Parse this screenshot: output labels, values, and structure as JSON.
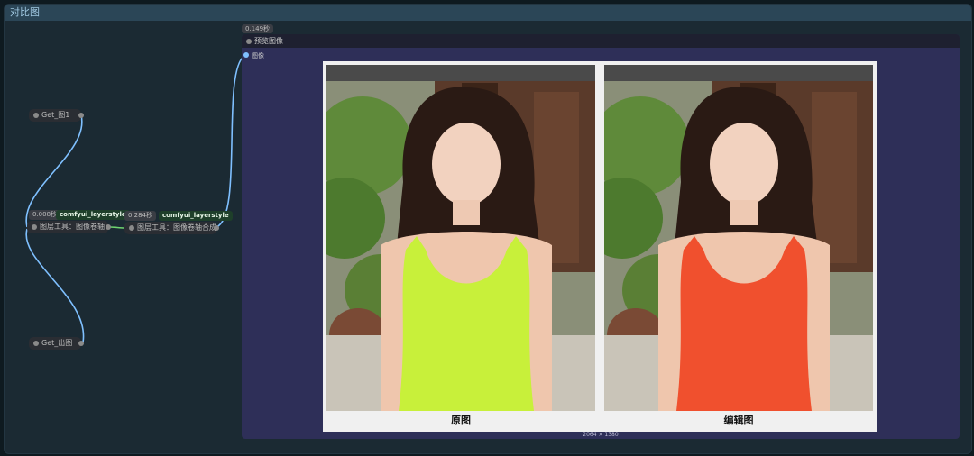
{
  "group": {
    "title": "对比图"
  },
  "nodes": {
    "get1": {
      "label": "Get_图1"
    },
    "getOut": {
      "label": "Get_出图"
    },
    "axis": {
      "time": "0.008秒",
      "tag": "comfyui_layerstyle",
      "label": "图层工具：图像卷轴"
    },
    "axisMerge": {
      "time": "0.284秒",
      "tag": "comfyui_layerstyle",
      "label": "图层工具：图像卷轴合成"
    }
  },
  "preview": {
    "time": "0.149秒",
    "title": "预览图像",
    "input_label": "图像",
    "left_caption": "原图",
    "right_caption": "编辑图",
    "dims": "2064 × 1380"
  },
  "colors": {
    "wire_image": "#7fc0ff",
    "wire_green": "#6fd36f",
    "dress_original": "#c8f03a",
    "dress_edited": "#f0502e"
  }
}
